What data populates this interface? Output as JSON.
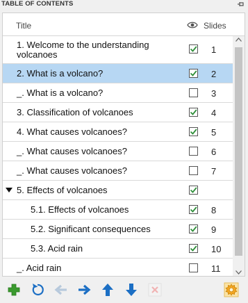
{
  "panel_title": "TABLE OF CONTENTS",
  "columns": {
    "title": "Title",
    "visibility_icon": "eye-icon",
    "slides": "Slides"
  },
  "rows": [
    {
      "text": "1. Welcome to the understanding volcanoes",
      "line1": "1. Welcome to the understanding",
      "line2": "volcanoes",
      "checked": true,
      "slide": "1",
      "selected": false
    },
    {
      "text": "2. What is a volcano?",
      "checked": true,
      "slide": "2",
      "selected": true
    },
    {
      "text": "_. What is a volcano?",
      "checked": false,
      "slide": "3",
      "selected": false
    },
    {
      "text": "3. Classification of volcanoes",
      "checked": true,
      "slide": "4",
      "selected": false
    },
    {
      "text": "4. What causes volcanoes?",
      "checked": true,
      "slide": "5",
      "selected": false
    },
    {
      "text": "_. What causes volcanoes?",
      "checked": false,
      "slide": "6",
      "selected": false
    },
    {
      "text": "_. What causes volcanoes?",
      "checked": false,
      "slide": "7",
      "selected": false
    },
    {
      "text": "5. Effects of volcanoes",
      "checked": true,
      "slide": "",
      "selected": false,
      "expanded": true
    },
    {
      "text": "5.1. Effects of volcanoes",
      "checked": true,
      "slide": "8",
      "selected": false
    },
    {
      "text": "5.2. Significant consequences",
      "checked": true,
      "slide": "9",
      "selected": false
    },
    {
      "text": "5.3. Acid rain",
      "checked": true,
      "slide": "10",
      "selected": false
    },
    {
      "text": "_. Acid rain",
      "checked": false,
      "slide": "11",
      "selected": false
    }
  ],
  "toolbar": [
    {
      "name": "add-icon",
      "enabled": true
    },
    {
      "name": "reset-icon",
      "enabled": true
    },
    {
      "name": "outdent-left-arrow-icon",
      "enabled": false
    },
    {
      "name": "indent-right-arrow-icon",
      "enabled": true
    },
    {
      "name": "move-up-arrow-icon",
      "enabled": true
    },
    {
      "name": "move-down-arrow-icon",
      "enabled": true
    },
    {
      "name": "delete-x-icon",
      "enabled": false
    },
    {
      "name": "settings-gear-icon",
      "enabled": true
    }
  ],
  "colors": {
    "accent_blue": "#1c6fc4",
    "add_green": "#3a9a2e",
    "selected_row": "#b7d7f3",
    "check_green": "#2f8f3a",
    "settings_orange": "#f2a623"
  }
}
